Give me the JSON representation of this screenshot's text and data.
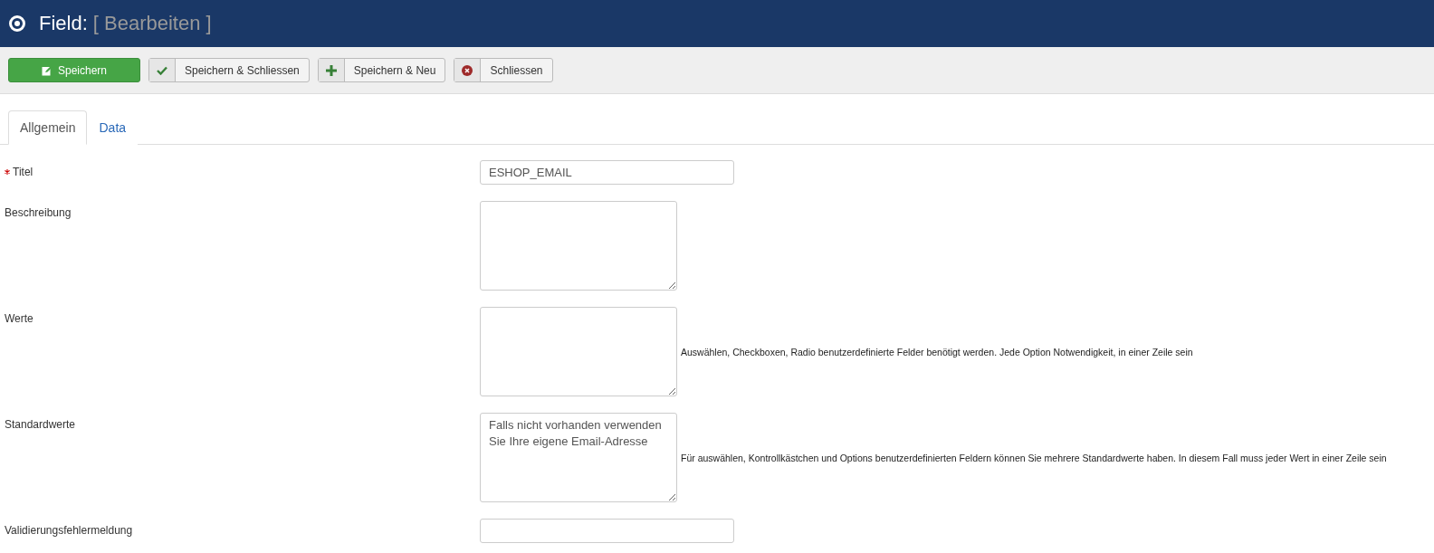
{
  "header": {
    "title": "Field:",
    "subtitle": "[ Bearbeiten ]"
  },
  "toolbar": [
    {
      "label": "Speichern",
      "kind": "primary"
    },
    {
      "label": "Speichern & Schliessen",
      "kind": "default"
    },
    {
      "label": "Speichern & Neu",
      "kind": "default"
    },
    {
      "label": "Schliessen",
      "kind": "default"
    }
  ],
  "tabs": [
    {
      "label": "Allgemein",
      "selected": true
    },
    {
      "label": "Data",
      "selected": false
    }
  ],
  "fields": [
    {
      "label": "Titel",
      "required": true,
      "kind": "input",
      "value": "ESHOP_EMAIL"
    },
    {
      "label": "Beschreibung",
      "required": false,
      "kind": "textarea"
    },
    {
      "label": "Werte",
      "required": false,
      "kind": "textarea",
      "help": "Auswählen, Checkboxen, Radio benutzerdefinierte Felder benötigt werden. Jede Option Notwendigkeit, in einer Zeile sein"
    },
    {
      "label": "Standardwerte",
      "required": false,
      "kind": "textarea",
      "value": "Falls nicht vorhanden verwenden Sie Ihre eigene Email-Adresse",
      "help": "Für auswählen, Kontrollkästchen und Options benutzerdefinierten Feldern können Sie mehrere Standardwerte haben. In diesem Fall muss jeder Wert in einer Zeile sein"
    },
    {
      "label": "Validierungsfehlermeldung",
      "required": false,
      "kind": "input"
    }
  ]
}
